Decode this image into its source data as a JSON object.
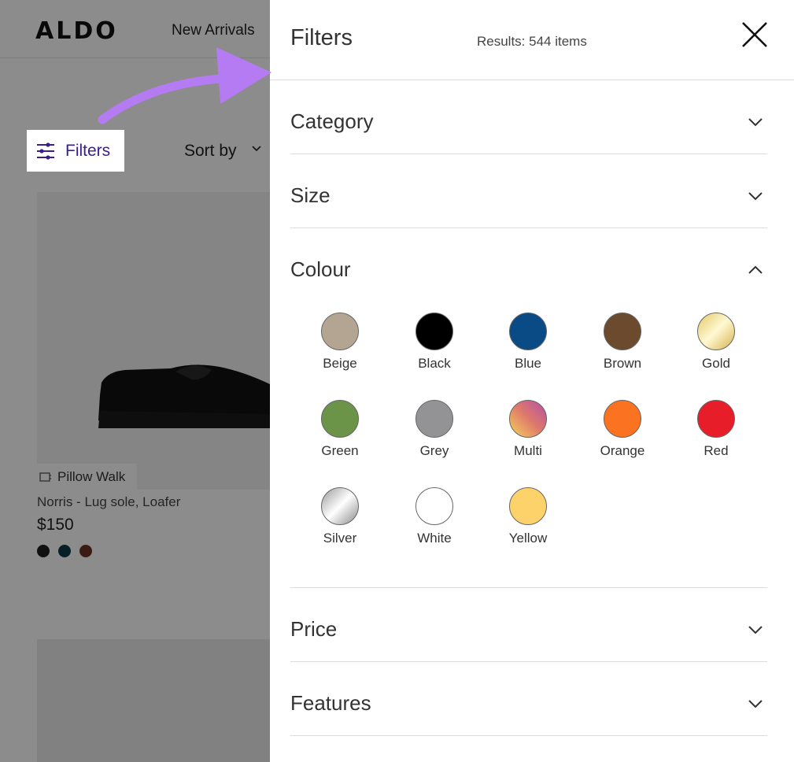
{
  "header": {
    "logo": "ALDO",
    "nav_new_arrivals": "New Arrivals"
  },
  "toolbar": {
    "filters_label": "Filters",
    "sort_label": "Sort by"
  },
  "product": {
    "badge": "Pillow Walk",
    "name": "Norris - Lug sole, Loafer",
    "price": "$150",
    "variant_colors": [
      "#1f1f1f",
      "#0e3a48",
      "#6b3425"
    ]
  },
  "panel": {
    "title": "Filters",
    "results": "Results: 544 items",
    "sections": {
      "category": "Category",
      "size": "Size",
      "colour": "Colour",
      "price": "Price",
      "features": "Features"
    },
    "colours": [
      {
        "name": "Beige",
        "color": "#b4a592"
      },
      {
        "name": "Black",
        "color": "#000000"
      },
      {
        "name": "Blue",
        "color": "#0a4a85"
      },
      {
        "name": "Brown",
        "color": "#6b4a2e"
      },
      {
        "name": "Gold",
        "color": "gold-gradient"
      },
      {
        "name": "Green",
        "color": "#6b9448"
      },
      {
        "name": "Grey",
        "color": "#939396"
      },
      {
        "name": "Multi",
        "color": "multi-gradient"
      },
      {
        "name": "Orange",
        "color": "#fb7320"
      },
      {
        "name": "Red",
        "color": "#e81d2a"
      },
      {
        "name": "Silver",
        "color": "silver-gradient"
      },
      {
        "name": "White",
        "color": "#ffffff"
      },
      {
        "name": "Yellow",
        "color": "#fdd26a"
      }
    ]
  },
  "accent_color": "#3a1d8f",
  "arrow_color": "#b57bf2"
}
